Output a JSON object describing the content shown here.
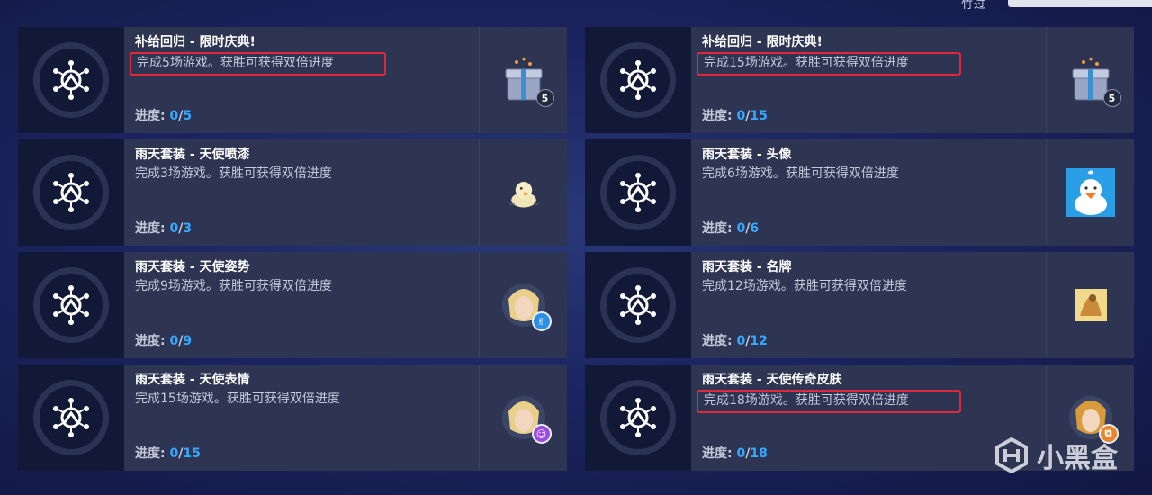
{
  "topbar": {
    "fragment_text": "竹过"
  },
  "cards": [
    {
      "title": "补给回归 - 限时庆典!",
      "desc": "完成5场游戏。获胜可获得双倍进度",
      "progress_label": "进度:",
      "current": "0",
      "sep": "/",
      "total": "5",
      "reward_icon": "loot-box-icon",
      "reward_count": "5",
      "highlighted": true
    },
    {
      "title": "补给回归 - 限时庆典!",
      "desc": "完成15场游戏。获胜可获得双倍进度",
      "progress_label": "进度:",
      "current": "0",
      "sep": "/",
      "total": "15",
      "reward_icon": "loot-box-icon",
      "reward_count": "5",
      "highlighted": true
    },
    {
      "title": "雨天套装 - 天使喷漆",
      "desc": "完成3场游戏。获胜可获得双倍进度",
      "progress_label": "进度:",
      "current": "0",
      "sep": "/",
      "total": "3",
      "reward_icon": "spray-icon",
      "highlighted": false
    },
    {
      "title": "雨天套装 - 头像",
      "desc": "完成6场游戏。获胜可获得双倍进度",
      "progress_label": "进度:",
      "current": "0",
      "sep": "/",
      "total": "6",
      "reward_icon": "player-icon-duck",
      "highlighted": false
    },
    {
      "title": "雨天套装 - 天使姿势",
      "desc": "完成9场游戏。获胜可获得双倍进度",
      "progress_label": "进度:",
      "current": "0",
      "sep": "/",
      "total": "9",
      "reward_icon": "victory-pose-icon",
      "highlighted": false
    },
    {
      "title": "雨天套装 - 名牌",
      "desc": "完成12场游戏。获胜可获得双倍进度",
      "progress_label": "进度:",
      "current": "0",
      "sep": "/",
      "total": "12",
      "reward_icon": "name-card-icon",
      "highlighted": false
    },
    {
      "title": "雨天套装 - 天使表情",
      "desc": "完成15场游戏。获胜可获得双倍进度",
      "progress_label": "进度:",
      "current": "0",
      "sep": "/",
      "total": "15",
      "reward_icon": "emote-icon",
      "highlighted": false
    },
    {
      "title": "雨天套装 - 天使传奇皮肤",
      "desc": "完成18场游戏。获胜可获得双倍进度",
      "progress_label": "进度:",
      "current": "0",
      "sep": "/",
      "total": "18",
      "reward_icon": "legendary-skin-icon",
      "highlighted": true
    }
  ],
  "watermark": {
    "text": "小黑盒"
  },
  "colors": {
    "progress_blue": "#36a8ff",
    "highlight_red": "#e0283c",
    "card_bg": "#2e3553",
    "icon_panel_bg": "#121936"
  }
}
